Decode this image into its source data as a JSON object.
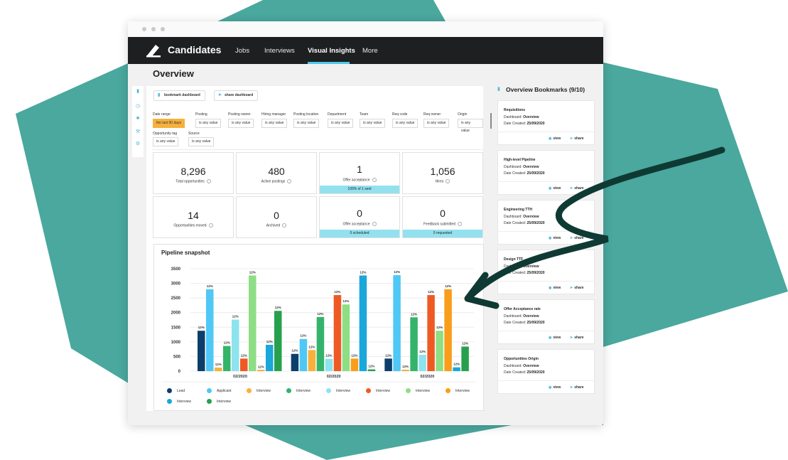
{
  "nav": {
    "brand": "Candidates",
    "items": [
      "Jobs",
      "Interviews",
      "Visual Insights",
      "More"
    ],
    "active": "Visual Insights"
  },
  "page": {
    "title": "Overview",
    "bookmark_button": "bookmark dashboard",
    "share_button": "share dashboard"
  },
  "filters": {
    "row1": [
      {
        "label": "Date range",
        "value": "the last 90 days",
        "highlight": true
      },
      {
        "label": "Posting",
        "value": "is any value"
      },
      {
        "label": "Posting owner",
        "value": "is any value"
      },
      {
        "label": "Hiring manager",
        "value": "is any value"
      },
      {
        "label": "Posting location",
        "value": "is any value"
      },
      {
        "label": "Department",
        "value": "is any value"
      },
      {
        "label": "Team",
        "value": "is any value"
      },
      {
        "label": "Req code",
        "value": "is any value"
      },
      {
        "label": "Req owner",
        "value": "is any value"
      },
      {
        "label": "Origin",
        "value": "is any value"
      }
    ],
    "row2": [
      {
        "label": "Opportunity tag",
        "value": "is any value"
      },
      {
        "label": "Source",
        "value": "is any value"
      }
    ]
  },
  "metrics": [
    {
      "value": "8,296",
      "label": "Total opportunities",
      "footer": ""
    },
    {
      "value": "480",
      "label": "Active postings",
      "footer": ""
    },
    {
      "value": "1",
      "label": "Offer acceptance",
      "footer": "100% of 1 sent"
    },
    {
      "value": "1,056",
      "label": "Hires",
      "footer": ""
    },
    {
      "value": "14",
      "label": "Opportunities moved",
      "footer": ""
    },
    {
      "value": "0",
      "label": "Archived",
      "footer": ""
    },
    {
      "value": "0",
      "label": "Offer acceptance",
      "footer": "0 scheduled"
    },
    {
      "value": "0",
      "label": "Feedback submitted",
      "footer": "0 requested"
    }
  ],
  "chart_title": "Pipeline snapshot",
  "chart_data": {
    "type": "bar",
    "title": "Pipeline snapshot",
    "categories": [
      "02/2020",
      "02/2020",
      "02/2020"
    ],
    "ylim": [
      0,
      3500
    ],
    "yticks": [
      0,
      500,
      1000,
      1500,
      2000,
      2500,
      3000,
      3500
    ],
    "grid": true,
    "legend_position": "bottom",
    "bar_label": "12%",
    "series": [
      {
        "name": "Lead",
        "color": "#0d3e6b",
        "values": [
          1380,
          590,
          430
        ]
      },
      {
        "name": "Applicant",
        "color": "#4fc8f5",
        "values": [
          2800,
          1100,
          3280
        ]
      },
      {
        "name": "Interview",
        "color": "#f6b13d",
        "values": [
          120,
          720,
          50
        ]
      },
      {
        "name": "Interview",
        "color": "#34b46a",
        "values": [
          860,
          1850,
          1840
        ]
      },
      {
        "name": "Interview",
        "color": "#8ee3ee",
        "values": [
          1760,
          420,
          560
        ]
      },
      {
        "name": "Interview",
        "color": "#ef5a24",
        "values": [
          430,
          2600,
          2600
        ]
      },
      {
        "name": "Interview",
        "color": "#8ede84",
        "values": [
          3270,
          2280,
          1380
        ]
      },
      {
        "name": "Interview",
        "color": "#f89e1b",
        "values": [
          40,
          430,
          2800
        ]
      },
      {
        "name": "Interview",
        "color": "#1aa7d9",
        "values": [
          900,
          3270,
          130
        ]
      },
      {
        "name": "Interview",
        "color": "#27a04d",
        "values": [
          2060,
          60,
          840
        ]
      }
    ]
  },
  "sidebar": {
    "title": "Overview Bookmarks (9/10)",
    "dashboard_label": "Dashboard:",
    "date_label": "Date Created:",
    "view_label": "view",
    "share_label": "share",
    "bookmarks": [
      {
        "title": "Requisitions",
        "dashboard": "Overview",
        "date": "25/09/2020"
      },
      {
        "title": "High-level Pipeline",
        "dashboard": "Overview",
        "date": "25/09/2020"
      },
      {
        "title": "Engineering TTH",
        "dashboard": "Overview",
        "date": "25/09/2020"
      },
      {
        "title": "Design TTF",
        "dashboard": "Overview",
        "date": "25/09/2020"
      },
      {
        "title": "Offer Acceptance rate",
        "dashboard": "Overview",
        "date": "25/09/2020"
      },
      {
        "title": "Opportunities Origin",
        "dashboard": "Overview",
        "date": "25/09/2020"
      }
    ]
  },
  "colors": {
    "nav_bg": "#1d1f21",
    "accent": "#4fc8e9",
    "teal_shape": "#4aa89e",
    "arrow": "#0f3a33"
  }
}
